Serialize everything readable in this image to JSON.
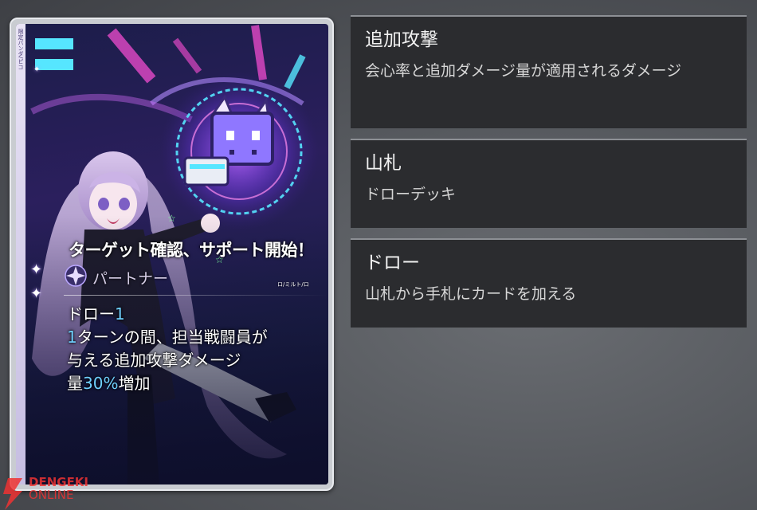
{
  "card": {
    "strip_text": "限定パンダ/ピコ",
    "title": "ターゲット確認、サポート開始！",
    "type_label": "パートナー",
    "type_icon": "sparkle-star-icon",
    "small_tag": "ロ/ミルト/ロ",
    "effect": {
      "line1_prefix": "ドロー",
      "line1_value": "1",
      "line2_value": "1",
      "line2_text": "ターンの間、担当戦闘員が",
      "line3_text": "与える追加攻撃ダメージ",
      "line4_prefix": "量",
      "line4_value": "30%",
      "line4_suffix": "増加"
    },
    "accent_color": "#6fd0ff"
  },
  "glossary": [
    {
      "term": "追加攻撃",
      "description": "会心率と追加ダメージ量が適用されるダメージ"
    },
    {
      "term": "山札",
      "description": "ドローデッキ"
    },
    {
      "term": "ドロー",
      "description": "山札から手札にカードを加える"
    }
  ],
  "watermark": {
    "line1": "DENGEKI",
    "line2": "ONLINE",
    "small": "電撃オンライン"
  }
}
